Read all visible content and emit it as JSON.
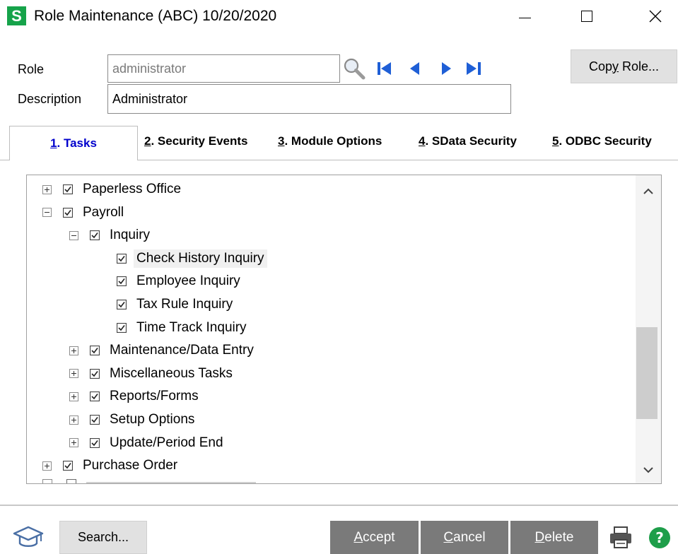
{
  "window": {
    "app_logo": "S",
    "title": "Role Maintenance (ABC) 10/20/2020",
    "minimize_icon": "minimize-icon",
    "maximize_icon": "maximize-icon",
    "close_icon": "close-icon"
  },
  "header": {
    "role_label": "Role",
    "role_value": "administrator",
    "description_label": "Description",
    "description_value": "Administrator",
    "copy_role_button": {
      "prefix": "Cop",
      "accel": "y",
      "suffix": " Role..."
    },
    "nav_icons": [
      "magnifier-lookup-icon",
      "first-record-icon",
      "previous-record-icon",
      "next-record-icon",
      "last-record-icon"
    ]
  },
  "tabs": [
    {
      "num": "1",
      "label": ". Tasks",
      "active": true
    },
    {
      "num": "2",
      "label": ". Security Events",
      "active": false
    },
    {
      "num": "3",
      "label": ". Module Options",
      "active": false
    },
    {
      "num": "4",
      "label": ". SData Security",
      "active": false
    },
    {
      "num": "5",
      "label": ". ODBC Security",
      "active": false
    }
  ],
  "tree": {
    "items": [
      {
        "label": "Paperless Office",
        "level": 0,
        "expander": "plus",
        "checked": true
      },
      {
        "label": "Payroll",
        "level": 0,
        "expander": "minus",
        "checked": true
      },
      {
        "label": "Inquiry",
        "level": 1,
        "expander": "minus",
        "checked": true
      },
      {
        "label": "Check History Inquiry",
        "level": 2,
        "expander": "none",
        "checked": true,
        "highlighted": true
      },
      {
        "label": "Employee Inquiry",
        "level": 2,
        "expander": "none",
        "checked": true
      },
      {
        "label": "Tax Rule Inquiry",
        "level": 2,
        "expander": "none",
        "checked": true
      },
      {
        "label": "Time Track Inquiry",
        "level": 2,
        "expander": "none",
        "checked": true
      },
      {
        "label": "Maintenance/Data Entry",
        "level": 1,
        "expander": "plus",
        "checked": true
      },
      {
        "label": "Miscellaneous Tasks",
        "level": 1,
        "expander": "plus",
        "checked": true
      },
      {
        "label": "Reports/Forms",
        "level": 1,
        "expander": "plus",
        "checked": true
      },
      {
        "label": "Setup Options",
        "level": 1,
        "expander": "plus",
        "checked": true
      },
      {
        "label": "Update/Period End",
        "level": 1,
        "expander": "plus",
        "checked": true
      },
      {
        "label": "Purchase Order",
        "level": 0,
        "expander": "plus",
        "checked": true
      }
    ]
  },
  "footer": {
    "help_cap_icon": "graduation-cap-icon",
    "search_button": "Search...",
    "accept_button": {
      "accel": "A",
      "rest": "ccept"
    },
    "cancel_button": {
      "accel": "C",
      "rest": "ancel"
    },
    "delete_button": {
      "accel": "D",
      "rest": "elete"
    },
    "print_icon": "printer-icon",
    "help_icon": "help-question-icon"
  },
  "colors": {
    "app_logo": "#16a34a",
    "active_tab_text": "#0000cc",
    "action_button_bg": "#7a7a7a",
    "nav_arrow": "#1f5fd6",
    "help_icon": "#1e9e4a"
  }
}
